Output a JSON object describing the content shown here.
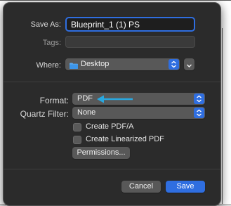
{
  "dialog": {
    "save_as_label": "Save As:",
    "save_as_value": "Blueprint_1 (1) PS",
    "tags_label": "Tags:",
    "tags_value": "",
    "where_label": "Where:",
    "where_value": "Desktop",
    "format_label": "Format:",
    "format_value": "PDF",
    "quartz_label": "Quartz Filter:",
    "quartz_value": "None",
    "create_pdfa_label": "Create PDF/A",
    "create_pdfa_checked": false,
    "create_linearized_label": "Create Linearized PDF",
    "create_linearized_checked": false,
    "permissions_label": "Permissions...",
    "cancel_label": "Cancel",
    "save_label": "Save"
  },
  "icons": {
    "folder": "folder-icon",
    "stepper": "up-down-chevron-icon",
    "expand": "chevron-down-icon",
    "annotation": "arrow-left-icon"
  },
  "colors": {
    "accent": "#2f6ee0",
    "annotation_arrow": "#29a8e0",
    "dialog_bg": "#2b2b2b"
  }
}
